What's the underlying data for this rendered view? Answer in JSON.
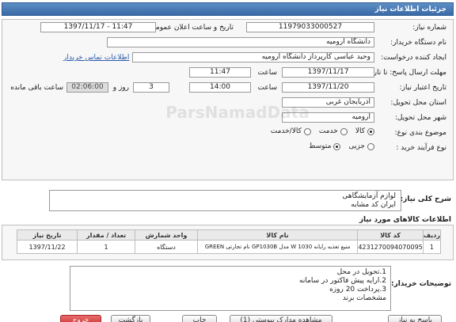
{
  "header": {
    "title": "جزئیات اطلاعات نیاز"
  },
  "form": {
    "need_number": {
      "label": "شماره نیاز:",
      "value": "11979033000527"
    },
    "announce_datetime": {
      "label": "تاریخ و ساعت اعلان عمومی:",
      "value": "1397/11/17 - 11:47"
    },
    "buyer_org": {
      "label": "نام دستگاه خریدار:",
      "value": "دانشگاه ارومیه"
    },
    "requester": {
      "label": "ایجاد کننده درخواست:",
      "value": "وحید عباسی کارپرداز دانشگاه ارومیه"
    },
    "buyer_contact_link": "اطلاعات تماس خریدار",
    "reply_deadline": {
      "label": "مهلت ارسال پاسخ: تا تاریخ:",
      "date": "1397/11/17",
      "time_label": "ساعت",
      "time": "11:47"
    },
    "validity_deadline": {
      "label": "تاریخ اعتبار نیاز:",
      "date": "1397/11/20",
      "time_label": "ساعت",
      "time": "14:00",
      "days": "3",
      "days_label": "روز و",
      "remaining": "02:06:00",
      "remaining_label": "ساعت باقی مانده"
    },
    "province": {
      "label": "استان محل تحویل:",
      "value": "آذربایجان غربی"
    },
    "city": {
      "label": "شهر محل تحویل:",
      "value": "ارومیه"
    },
    "category": {
      "label": "موضوع بندی نوع:",
      "options": [
        "کالا",
        "خدمت",
        "کالا/خدمت"
      ],
      "selected": "کالا"
    },
    "purchase_process": {
      "label": "نوع فرآیند خرید :",
      "options": [
        "جزیی",
        "متوسط"
      ],
      "selected": "متوسط"
    }
  },
  "needs": {
    "label": "شرح کلی نیاز:",
    "lines": [
      "لوازم آزمایشگاهی",
      "ایران کد مشابه"
    ]
  },
  "goods": {
    "title": "اطلاعات کالاهای مورد نیاز",
    "columns": [
      "ردیف",
      "کد کالا",
      "نام کالا",
      "واحد شمارش",
      "تعداد / مقدار",
      "تاریخ نیاز"
    ],
    "rows": [
      [
        "1",
        "4231270094070095",
        "منبع تغذیه رایانه 1030 W مدل GP1030B نام تجارتی GREEN",
        "دستگاه",
        "1",
        "1397/11/22"
      ]
    ]
  },
  "buyer_notes": {
    "label": "توضیحات خریدار:",
    "lines": [
      "1.تحویل در محل",
      "2.ارایه پیش فاکتور در سامانه",
      "3.پرداخت 20 روزه",
      "مشخصات برند"
    ]
  },
  "buttons": {
    "reply": "پاسخ به نیاز",
    "view_docs": "مشاهده مدارک پیوستی (1)",
    "print": "چاپ",
    "back": "بازگشت",
    "exit": "خروج"
  },
  "watermark": "ParsNamadData"
}
